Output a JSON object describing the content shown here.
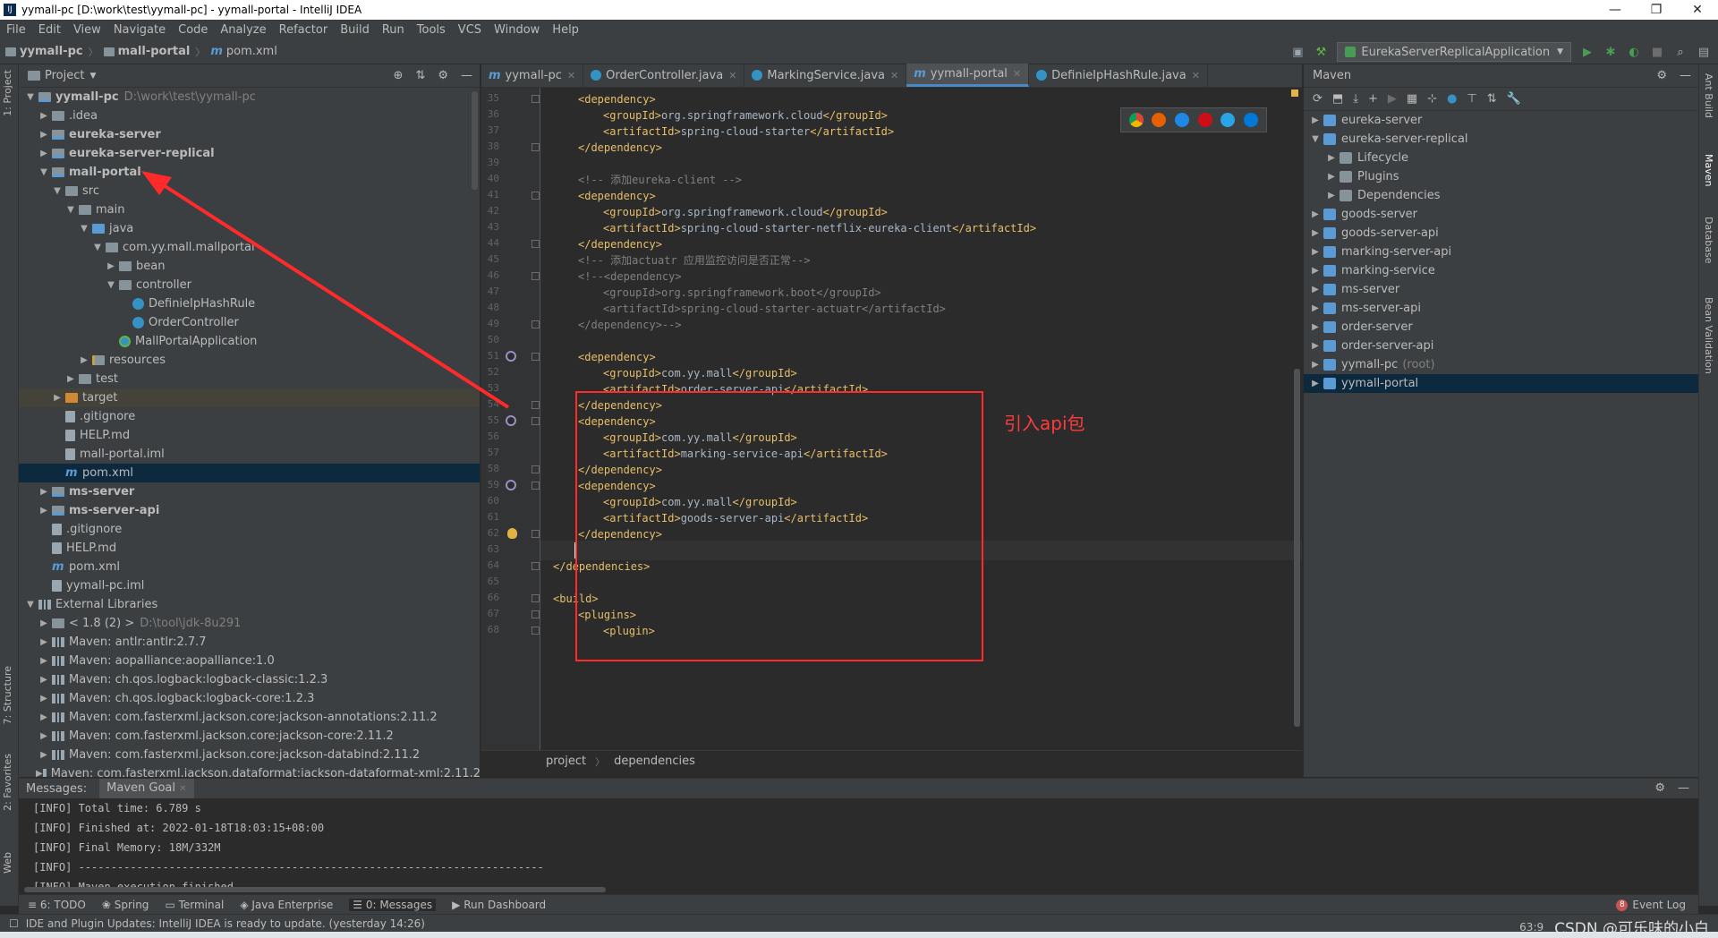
{
  "window": {
    "title": "yymall-pc [D:\\work\\test\\yymall-pc] - yymall-portal - IntelliJ IDEA",
    "controls": [
      "—",
      "❐",
      "✕"
    ]
  },
  "menu": [
    "File",
    "Edit",
    "View",
    "Navigate",
    "Code",
    "Analyze",
    "Refactor",
    "Build",
    "Run",
    "Tools",
    "VCS",
    "Window",
    "Help"
  ],
  "breadcrumbs": [
    "yymall-pc",
    "mall-portal",
    "pom.xml"
  ],
  "run_config": "EurekaServerReplicalApplication",
  "left_tabs": [
    "1: Project",
    "7: Structure",
    "2: Favorites",
    "Web"
  ],
  "right_tabs": [
    "Ant Build",
    "Maven",
    "Database",
    "Bean Validation"
  ],
  "project_panel": {
    "title": "Project",
    "tree": [
      {
        "indent": 0,
        "arrow": "▼",
        "icon": "folder-mod",
        "label": "yymall-pc",
        "bold": true,
        "path": "D:\\work\\test\\yymall-pc"
      },
      {
        "indent": 1,
        "arrow": "▶",
        "icon": "folder",
        "label": ".idea"
      },
      {
        "indent": 1,
        "arrow": "▶",
        "icon": "folder-mod",
        "label": "eureka-server",
        "bold": true
      },
      {
        "indent": 1,
        "arrow": "▶",
        "icon": "folder-mod",
        "label": "eureka-server-replical",
        "bold": true
      },
      {
        "indent": 1,
        "arrow": "▼",
        "icon": "folder-mod",
        "label": "mall-portal",
        "bold": true
      },
      {
        "indent": 2,
        "arrow": "▼",
        "icon": "folder",
        "label": "src"
      },
      {
        "indent": 3,
        "arrow": "▼",
        "icon": "folder",
        "label": "main"
      },
      {
        "indent": 4,
        "arrow": "▼",
        "icon": "folder-src",
        "label": "java"
      },
      {
        "indent": 5,
        "arrow": "▼",
        "icon": "folder",
        "label": "com.yy.mall.mallportal"
      },
      {
        "indent": 6,
        "arrow": "▶",
        "icon": "folder",
        "label": "bean"
      },
      {
        "indent": 6,
        "arrow": "▼",
        "icon": "folder",
        "label": "controller"
      },
      {
        "indent": 7,
        "arrow": "",
        "icon": "cls",
        "label": "DefinieIpHashRule"
      },
      {
        "indent": 7,
        "arrow": "",
        "icon": "cls",
        "label": "OrderController"
      },
      {
        "indent": 6,
        "arrow": "",
        "icon": "cls-app",
        "label": "MallPortalApplication"
      },
      {
        "indent": 4,
        "arrow": "▶",
        "icon": "folder-res",
        "label": "resources"
      },
      {
        "indent": 3,
        "arrow": "▶",
        "icon": "folder",
        "label": "test"
      },
      {
        "indent": 2,
        "arrow": "▶",
        "icon": "folder-orange",
        "label": "target",
        "highlight": true
      },
      {
        "indent": 2,
        "arrow": "",
        "icon": "file",
        "label": ".gitignore"
      },
      {
        "indent": 2,
        "arrow": "",
        "icon": "file",
        "label": "HELP.md"
      },
      {
        "indent": 2,
        "arrow": "",
        "icon": "file",
        "label": "mall-portal.iml"
      },
      {
        "indent": 2,
        "arrow": "",
        "icon": "mvn",
        "label": "pom.xml",
        "selected": true
      },
      {
        "indent": 1,
        "arrow": "▶",
        "icon": "folder-mod",
        "label": "ms-server",
        "bold": true
      },
      {
        "indent": 1,
        "arrow": "▶",
        "icon": "folder-mod",
        "label": "ms-server-api",
        "bold": true
      },
      {
        "indent": 1,
        "arrow": "",
        "icon": "file",
        "label": ".gitignore"
      },
      {
        "indent": 1,
        "arrow": "",
        "icon": "file",
        "label": "HELP.md"
      },
      {
        "indent": 1,
        "arrow": "",
        "icon": "mvn",
        "label": "pom.xml"
      },
      {
        "indent": 1,
        "arrow": "",
        "icon": "file",
        "label": "yymall-pc.iml"
      },
      {
        "indent": 0,
        "arrow": "▼",
        "icon": "lib",
        "label": "External Libraries"
      },
      {
        "indent": 1,
        "arrow": "▶",
        "icon": "folder",
        "label": "< 1.8 (2) >",
        "path": "D:\\tool\\jdk-8u291"
      },
      {
        "indent": 1,
        "arrow": "▶",
        "icon": "lib",
        "label": "Maven: antlr:antlr:2.7.7"
      },
      {
        "indent": 1,
        "arrow": "▶",
        "icon": "lib",
        "label": "Maven: aopalliance:aopalliance:1.0"
      },
      {
        "indent": 1,
        "arrow": "▶",
        "icon": "lib",
        "label": "Maven: ch.qos.logback:logback-classic:1.2.3"
      },
      {
        "indent": 1,
        "arrow": "▶",
        "icon": "lib",
        "label": "Maven: ch.qos.logback:logback-core:1.2.3"
      },
      {
        "indent": 1,
        "arrow": "▶",
        "icon": "lib",
        "label": "Maven: com.fasterxml.jackson.core:jackson-annotations:2.11.2"
      },
      {
        "indent": 1,
        "arrow": "▶",
        "icon": "lib",
        "label": "Maven: com.fasterxml.jackson.core:jackson-core:2.11.2"
      },
      {
        "indent": 1,
        "arrow": "▶",
        "icon": "lib",
        "label": "Maven: com.fasterxml.jackson.core:jackson-databind:2.11.2"
      },
      {
        "indent": 1,
        "arrow": "▶",
        "icon": "lib",
        "label": "Maven: com.fasterxml.jackson.dataformat:jackson-dataformat-xml:2.11.2"
      }
    ]
  },
  "editor": {
    "tabs": [
      {
        "icon": "m",
        "label": "yymall-pc",
        "active": false
      },
      {
        "icon": "c",
        "label": "OrderController.java",
        "active": false
      },
      {
        "icon": "c",
        "label": "MarkingService.java",
        "active": false
      },
      {
        "icon": "m",
        "label": "yymall-portal",
        "active": true
      },
      {
        "icon": "c",
        "label": "DefinieIpHashRule.java",
        "active": false
      }
    ],
    "lines": [
      {
        "n": "35",
        "indent": 1,
        "kind": "tag",
        "text": "<dependency>"
      },
      {
        "n": "36",
        "indent": 2,
        "kind": "mixed",
        "open": "<groupId>",
        "value": "org.springframework.cloud",
        "close": "</groupId>"
      },
      {
        "n": "37",
        "indent": 2,
        "kind": "mixed",
        "open": "<artifactId>",
        "value": "spring-cloud-starter",
        "close": "</artifactId>"
      },
      {
        "n": "38",
        "indent": 1,
        "kind": "tag",
        "text": "</dependency>"
      },
      {
        "n": "39",
        "indent": 0,
        "kind": "blank",
        "text": ""
      },
      {
        "n": "40",
        "indent": 1,
        "kind": "comment",
        "text": "<!-- 添加eureka-client -->"
      },
      {
        "n": "41",
        "indent": 1,
        "kind": "tag",
        "text": "<dependency>"
      },
      {
        "n": "42",
        "indent": 2,
        "kind": "mixed",
        "open": "<groupId>",
        "value": "org.springframework.cloud",
        "close": "</groupId>"
      },
      {
        "n": "43",
        "indent": 2,
        "kind": "mixed",
        "open": "<artifactId>",
        "value": "spring-cloud-starter-netflix-eureka-client",
        "close": "</artifactId>"
      },
      {
        "n": "44",
        "indent": 1,
        "kind": "tag",
        "text": "</dependency>"
      },
      {
        "n": "45",
        "indent": 1,
        "kind": "comment",
        "text": "<!-- 添加actuatr 应用监控访问是否正常-->"
      },
      {
        "n": "46",
        "indent": 1,
        "kind": "comment",
        "text": "<!--<dependency>"
      },
      {
        "n": "47",
        "indent": 2,
        "kind": "comment",
        "text": "<groupId>org.springframework.boot</groupId>"
      },
      {
        "n": "48",
        "indent": 2,
        "kind": "comment",
        "text": "<artifactId>spring-cloud-starter-actuatr</artifactId>"
      },
      {
        "n": "49",
        "indent": 1,
        "kind": "comment",
        "text": "</dependency>-->"
      },
      {
        "n": "50",
        "indent": 0,
        "kind": "blank",
        "text": ""
      },
      {
        "n": "51",
        "indent": 1,
        "kind": "tag",
        "text": "<dependency>"
      },
      {
        "n": "52",
        "indent": 2,
        "kind": "mixed",
        "open": "<groupId>",
        "value": "com.yy.mall",
        "close": "</groupId>"
      },
      {
        "n": "53",
        "indent": 2,
        "kind": "mixed",
        "open": "<artifactId>",
        "value": "order-server-api",
        "close": "</artifactId>"
      },
      {
        "n": "54",
        "indent": 1,
        "kind": "tag",
        "text": "</dependency>"
      },
      {
        "n": "55",
        "indent": 1,
        "kind": "tag",
        "text": "<dependency>"
      },
      {
        "n": "56",
        "indent": 2,
        "kind": "mixed",
        "open": "<groupId>",
        "value": "com.yy.mall",
        "close": "</groupId>"
      },
      {
        "n": "57",
        "indent": 2,
        "kind": "mixed",
        "open": "<artifactId>",
        "value": "marking-service-api",
        "close": "</artifactId>"
      },
      {
        "n": "58",
        "indent": 1,
        "kind": "tag",
        "text": "</dependency>"
      },
      {
        "n": "59",
        "indent": 1,
        "kind": "tag",
        "text": "<dependency>"
      },
      {
        "n": "60",
        "indent": 2,
        "kind": "mixed",
        "open": "<groupId>",
        "value": "com.yy.mall",
        "close": "</groupId>"
      },
      {
        "n": "61",
        "indent": 2,
        "kind": "mixed",
        "open": "<artifactId>",
        "value": "goods-server-api",
        "close": "</artifactId>"
      },
      {
        "n": "62",
        "indent": 1,
        "kind": "tag",
        "text": "</dependency>"
      },
      {
        "n": "63",
        "indent": 1,
        "kind": "blank",
        "text": ""
      },
      {
        "n": "64",
        "indent": 0,
        "kind": "tag",
        "text": "</dependencies>"
      },
      {
        "n": "65",
        "indent": 0,
        "kind": "blank",
        "text": ""
      },
      {
        "n": "66",
        "indent": 0,
        "kind": "tag",
        "text": "<build>"
      },
      {
        "n": "67",
        "indent": 1,
        "kind": "tag",
        "text": "<plugins>"
      },
      {
        "n": "68",
        "indent": 2,
        "kind": "tag",
        "text": "<plugin>"
      }
    ],
    "annotation": "引入api包",
    "breadcrumb": [
      "project",
      "dependencies"
    ]
  },
  "maven_panel": {
    "title": "Maven",
    "items": [
      {
        "indent": 0,
        "arrow": "▶",
        "label": "eureka-server"
      },
      {
        "indent": 0,
        "arrow": "▼",
        "label": "eureka-server-replical"
      },
      {
        "indent": 1,
        "arrow": "▶",
        "label": "Lifecycle",
        "sub": true
      },
      {
        "indent": 1,
        "arrow": "▶",
        "label": "Plugins",
        "sub": true
      },
      {
        "indent": 1,
        "arrow": "▶",
        "label": "Dependencies",
        "sub": true
      },
      {
        "indent": 0,
        "arrow": "▶",
        "label": "goods-server"
      },
      {
        "indent": 0,
        "arrow": "▶",
        "label": "goods-server-api"
      },
      {
        "indent": 0,
        "arrow": "▶",
        "label": "marking-server-api"
      },
      {
        "indent": 0,
        "arrow": "▶",
        "label": "marking-service"
      },
      {
        "indent": 0,
        "arrow": "▶",
        "label": "ms-server"
      },
      {
        "indent": 0,
        "arrow": "▶",
        "label": "ms-server-api"
      },
      {
        "indent": 0,
        "arrow": "▶",
        "label": "order-server"
      },
      {
        "indent": 0,
        "arrow": "▶",
        "label": "order-server-api"
      },
      {
        "indent": 0,
        "arrow": "▶",
        "label": "yymall-pc",
        "root": "(root)"
      },
      {
        "indent": 0,
        "arrow": "▶",
        "label": "yymall-portal",
        "selected": true
      }
    ]
  },
  "messages": {
    "label": "Messages:",
    "tab": "Maven Goal",
    "lines": [
      "[INFO] Total time: 6.789 s",
      "[INFO] Finished at: 2022-01-18T18:03:15+08:00",
      "[INFO] Final Memory: 18M/332M",
      "[INFO] ------------------------------------------------------------------------",
      "[INFO] Maven execution finished"
    ]
  },
  "bottom_tabs": [
    "6: TODO",
    "Spring",
    "Terminal",
    "Java Enterprise",
    "0: Messages",
    "Run Dashboard"
  ],
  "event_log": {
    "count": "8",
    "label": "Event Log"
  },
  "status": {
    "message": "IDE and Plugin Updates: IntelliJ IDEA is ready to update. (yesterday 14:26)",
    "position": "63:9",
    "watermark": "CSDN @可乐味的小白"
  }
}
